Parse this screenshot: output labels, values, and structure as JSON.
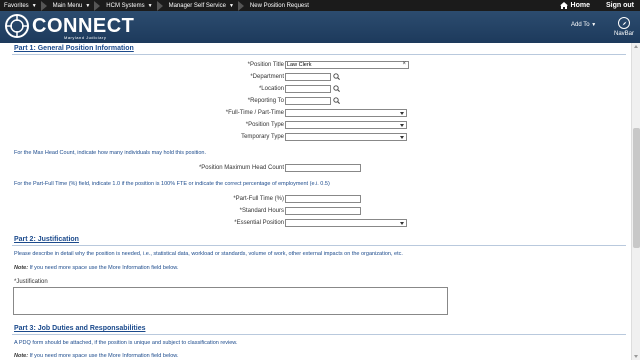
{
  "topbar": {
    "favorites": "Favorites",
    "main_menu": "Main Menu",
    "hcm": "HCM Systems",
    "mss": "Manager Self Service",
    "page": "New Position Request",
    "home": "Home",
    "signout": "Sign out"
  },
  "header": {
    "logo": "CONNECT",
    "logo_sub": "Maryland Judiciary",
    "addto": "Add To",
    "navbar": "NavBar",
    "bg_color": "#1d3a5c"
  },
  "part1": {
    "title": "Part 1: General Position Information",
    "position_title_label": "*Position Title",
    "position_title_value": "Law Clerk",
    "department_label": "*Department",
    "location_label": "*Location",
    "reporting_to_label": "*Reporting To",
    "ft_pt_label": "*Full-Time / Part-Time",
    "position_type_label": "*Position Type",
    "temporary_type_label": "Temporary Type",
    "max_head_note": "For the Max Head Count, indicate how many individuals may hold this position.",
    "max_head_label": "*Position Maximum Head Count",
    "fte_note": "For the Part-Full Time (%) field, indicate 1.0 if the position is 100% FTE or indicate the correct percentage of employment (e.i. 0.5)",
    "part_full_label": "*Part-Full Time (%)",
    "std_hours_label": "*Standard Hours",
    "essential_label": "*Essential Position"
  },
  "part2": {
    "title": "Part 2: Justification",
    "desc": "Please describe in detail why the position is needed, i.e., statistical data, workload or standards, volume of work, other external impacts on the organization, etc.",
    "note_label": "Note:",
    "note_text": " If you need more space use the More Information field below.",
    "justification_label": "*Justification"
  },
  "part3": {
    "title": "Part 3: Job Duties and Responsabilities",
    "desc": "A PDQ form should be attached, if the position is unique and subject to classification review.",
    "note_label": "Note:",
    "note_text": " If you need more space use the More Information field below."
  }
}
